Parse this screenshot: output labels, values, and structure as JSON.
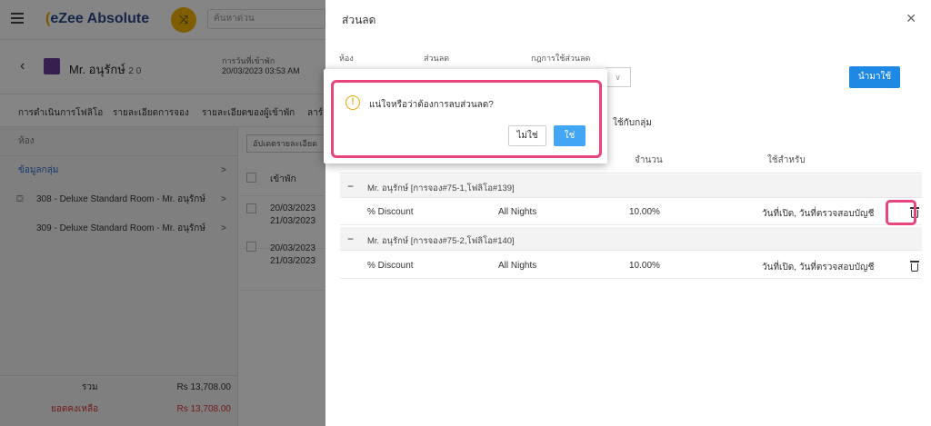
{
  "app": {
    "brand": "eZee Absolute",
    "search_placeholder": "ค้นหาด่วน",
    "guest_name": "Mr. อนุรักษ์",
    "guest_counts": "2  0",
    "checkin_label": "การวันที่เข้าพัก",
    "checkin_date": "20/03/2023 03:53 AM"
  },
  "tabs": [
    "การดำเนินการโฟลิโอ",
    "รายละเอียดการจอง",
    "รายละเอียดของผู้เข้าพัก",
    "ลาร์"
  ],
  "left_panel": {
    "header": "ห้อง",
    "group_item": "ข้อมูลกลุ่ม",
    "rooms": [
      "308 - Deluxe Standard Room - Mr. อนุรักษ์",
      "309 - Deluxe Standard Room - Mr. อนุรักษ์"
    ],
    "total_label": "รวม",
    "total_value": "Rs 13,708.00",
    "balance_label": "ยอดคงเหลือ",
    "balance_value": "Rs 13,708.00"
  },
  "mid_panel": {
    "update_btn": "อัปเดตรายละเอียด",
    "col_checkin": "เข้าพัก",
    "rows": [
      {
        "from": "20/03/2023",
        "to": "21/03/2023"
      },
      {
        "from": "20/03/2023",
        "to": "21/03/2023"
      }
    ]
  },
  "drawer": {
    "title": "ส่วนลด",
    "label_room": "ห้อง",
    "label_discount": "ส่วนลด",
    "label_rule": "กฎการใช้ส่วนลด",
    "apply_btn": "นำมาใช้",
    "apply_group": "ใช้กับกลุ่ม",
    "col_amount": "จำนวน",
    "col_apply_for": "ใช้สำหรับ",
    "groups": [
      {
        "title": "Mr. อนุรักษ์ [การจอง#75-1,โฟลิโอ#139]",
        "row": {
          "discount": "% Discount",
          "nights": "All Nights",
          "amount": "10.00%",
          "apply_for": "วันที่เปิด, วันที่ตรวจสอบบัญชี"
        }
      },
      {
        "title": "Mr. อนุรักษ์ [การจอง#75-2,โฟลิโอ#140]",
        "row": {
          "discount": "% Discount",
          "nights": "All Nights",
          "amount": "10.00%",
          "apply_for": "วันที่เปิด, วันที่ตรวจสอบบัญชี"
        }
      }
    ]
  },
  "dialog": {
    "message": "แน่ใจหรือว่าต้องการลบส่วนลด?",
    "no_label": "ไม่ใช่",
    "yes_label": "ใช่"
  },
  "colors": {
    "accent": "#1e88e5",
    "highlight": "#e8457a",
    "warning": "#f2a20c"
  }
}
